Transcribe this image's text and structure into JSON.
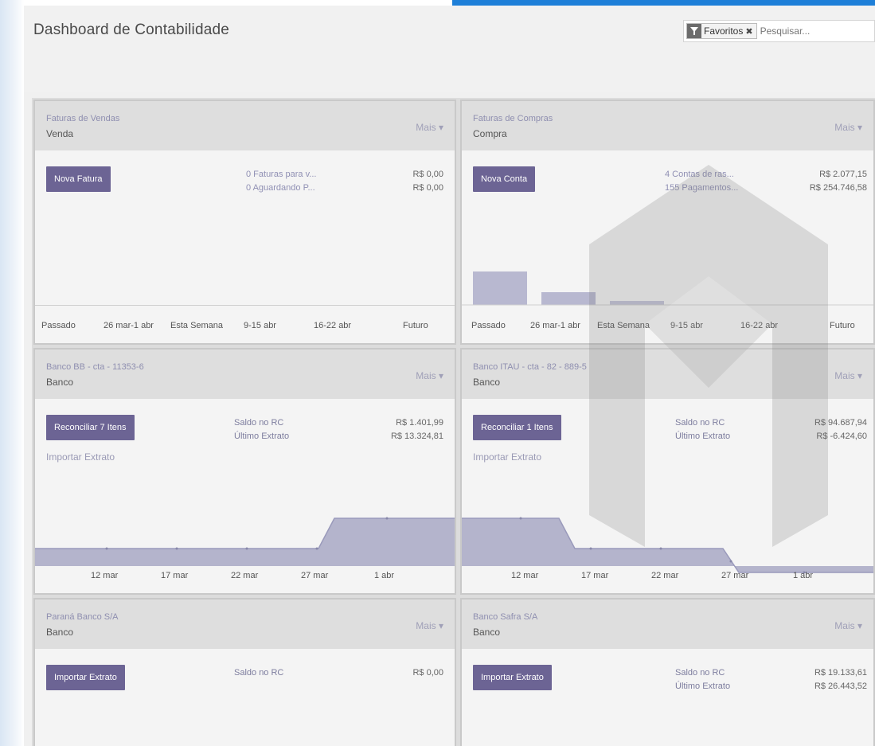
{
  "header": {
    "title": "Dashboard de Contabilidade",
    "filter_facet": "Favoritos",
    "search_placeholder": "Pesquisar..."
  },
  "cards": {
    "vendas": {
      "name": "Faturas de Vendas",
      "type": "Venda",
      "more": "Mais ▾",
      "button": "Nova Fatura",
      "stats": [
        {
          "label": "0 Faturas para v...",
          "value": "R$ 0,00"
        },
        {
          "label": "0 Aguardando P...",
          "value": "R$ 0,00"
        }
      ],
      "axis": [
        "Passado",
        "26 mar-1 abr",
        "Esta Semana",
        "9-15 abr",
        "16-22 abr",
        "Futuro"
      ]
    },
    "compras": {
      "name": "Faturas de Compras",
      "type": "Compra",
      "more": "Mais ▾",
      "button": "Nova Conta",
      "stats": [
        {
          "label": "4 Contas de ras...",
          "value": "R$ 2.077,15"
        },
        {
          "label": "155 Pagamentos...",
          "value": "R$ 254.746,58"
        }
      ],
      "axis": [
        "Passado",
        "26 mar-1 abr",
        "Esta Semana",
        "9-15 abr",
        "16-22 abr",
        "Futuro"
      ]
    },
    "bb": {
      "name": "Banco BB - cta - 11353-6",
      "type": "Banco",
      "more": "Mais ▾",
      "button": "Reconciliar 7 Itens",
      "import": "Importar Extrato",
      "stats": [
        {
          "label": "Saldo no RC",
          "value": "R$ 1.401,99"
        },
        {
          "label": "Último Extrato",
          "value": "R$ 13.324,81"
        }
      ],
      "axis": [
        "12 mar",
        "17 mar",
        "22 mar",
        "27 mar",
        "1 abr"
      ]
    },
    "itau": {
      "name": "Banco ITAU - cta - 82 - 889-5",
      "type": "Banco",
      "more": "Mais ▾",
      "button": "Reconciliar 1 Itens",
      "import": "Importar Extrato",
      "stats": [
        {
          "label": "Saldo no RC",
          "value": "R$ 94.687,94"
        },
        {
          "label": "Último Extrato",
          "value": "R$ -6.424,60"
        }
      ],
      "axis": [
        "12 mar",
        "17 mar",
        "22 mar",
        "27 mar",
        "1 abr"
      ]
    },
    "parana": {
      "name": "Paraná Banco S/A",
      "type": "Banco",
      "more": "Mais ▾",
      "button": "Importar Extrato",
      "stats": [
        {
          "label": "Saldo no RC",
          "value": "R$ 0,00"
        }
      ]
    },
    "safra": {
      "name": "Banco Safra S/A",
      "type": "Banco",
      "more": "Mais ▾",
      "button": "Importar Extrato",
      "stats": [
        {
          "label": "Saldo no RC",
          "value": "R$ 19.133,61"
        },
        {
          "label": "Último Extrato",
          "value": "R$ 26.443,52"
        }
      ]
    }
  },
  "colors": {
    "accent": "#6c6494",
    "chart_fill": "#b4b4cc",
    "chart_line": "#9a9abb",
    "top_bar": "#1e7fd8"
  }
}
